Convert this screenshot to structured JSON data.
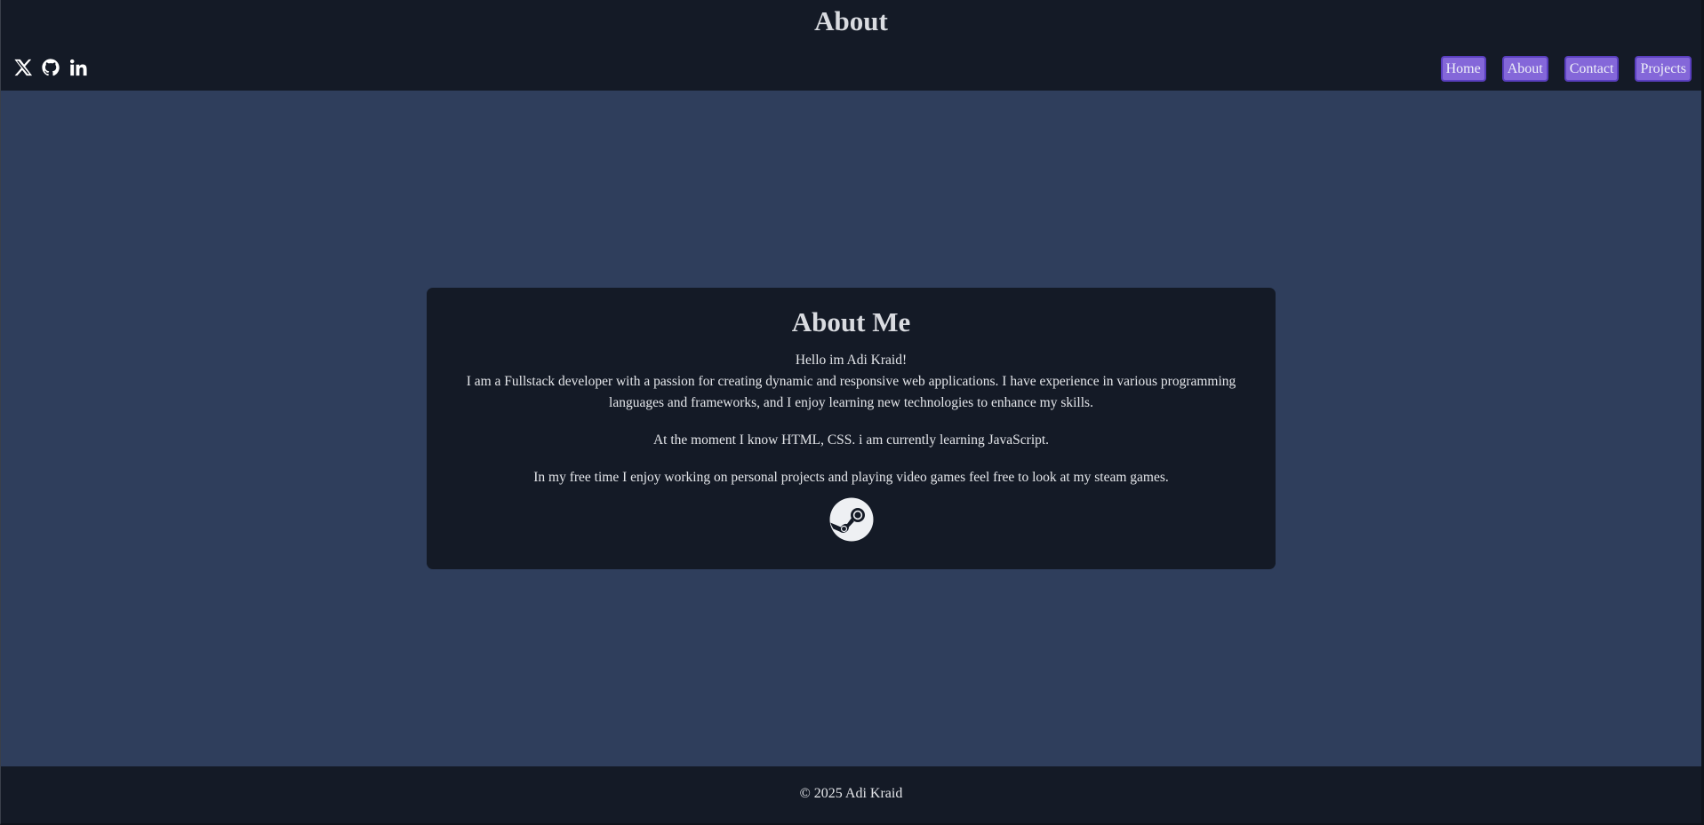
{
  "header": {
    "title": "About",
    "socials": [
      {
        "icon": "x-twitter-icon"
      },
      {
        "icon": "github-icon"
      },
      {
        "icon": "linkedin-icon"
      }
    ],
    "nav": [
      "Home",
      "About",
      "Contact",
      "Projects"
    ]
  },
  "about": {
    "heading": "About Me",
    "greeting": "Hello im Adi Kraid!",
    "intro": "I am a Fullstack developer with a passion for creating dynamic and responsive web applications. I have experience in various programming languages and frameworks, and I enjoy learning new technologies to enhance my skills.",
    "skills": "At the moment I know HTML, CSS. i am currently learning JavaScript.",
    "hobbies": "In my free time I enjoy working on personal projects and playing video games feel free to look at my steam games.",
    "steam_icon": "steam-icon"
  },
  "footer": {
    "copyright": "© 2025 Adi Kraid"
  },
  "colors": {
    "header_bg": "#141a26",
    "main_bg": "#2f3e5c",
    "nav_button": "#8467d9",
    "nav_border": "#5a3fbf"
  }
}
